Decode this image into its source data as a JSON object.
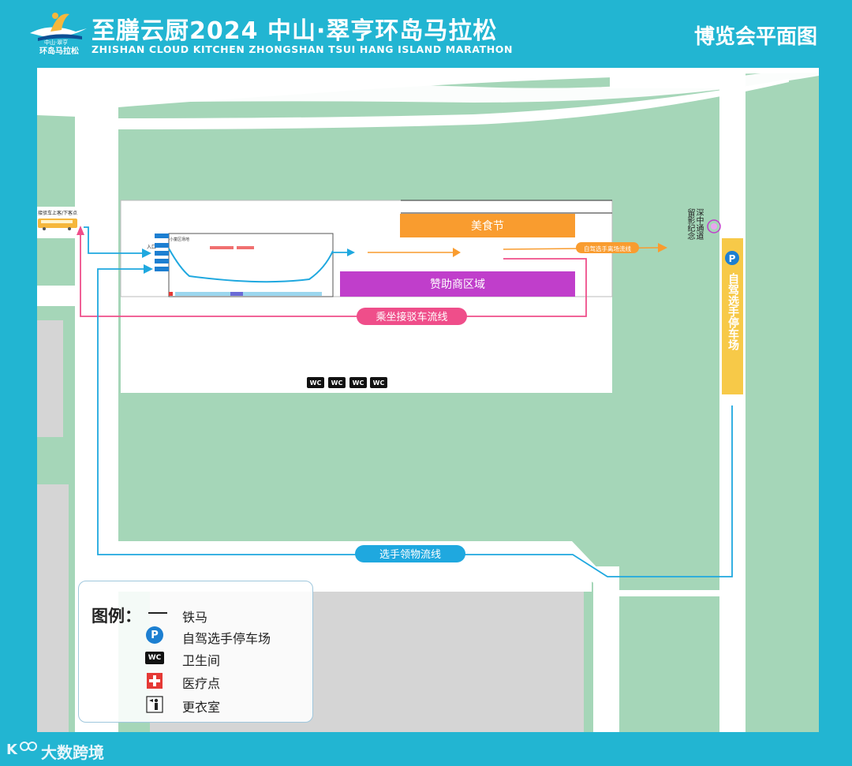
{
  "header": {
    "logo_text_line1": "中山·翠亨",
    "logo_text_line2": "环岛马拉松",
    "title": "至膳云厨2024 中山·翠亨环岛马拉松",
    "subtitle": "ZHISHAN CLOUD KITCHEN ZHONGSHAN TSUI HANG ISLAND MARATHON",
    "page_title": "博览会平面图"
  },
  "map": {
    "shuttle_stop_label": "接驳车上客/下客点",
    "entrance_label": "入口",
    "hall_label": "小童区场地",
    "food_zone": "美食节",
    "sponsor_zone": "赞助商区域",
    "self_drive_exit_flow": "自驾选手离场流线",
    "shuttle_flow": "乘坐接驳车流线",
    "pickup_flow": "选手领物流线",
    "tunnel_label": "深中通道留影纪念",
    "parking_label": "自驾选手停车场",
    "parking_symbol": "P",
    "wc_label": "WC",
    "colors": {
      "grass": "#a5d6b8",
      "road": "#ffffff",
      "food": "#f99c2f",
      "sponsor": "#c03ecb",
      "parking": "#f7c948",
      "pink_flow": "#ef4e8a",
      "blue_flow": "#1fa8df",
      "orange_flow": "#f99c2f"
    }
  },
  "legend": {
    "title": "图例：",
    "items": [
      {
        "symbol": "line",
        "label": "铁马"
      },
      {
        "symbol": "parking-icon",
        "label": "自驾选手停车场",
        "glyph": "P"
      },
      {
        "symbol": "wc-icon",
        "label": "卫生间",
        "glyph": "WC"
      },
      {
        "symbol": "medical-icon",
        "label": "医疗点"
      },
      {
        "symbol": "changing-room-icon",
        "label": "更衣室"
      }
    ]
  },
  "footer": {
    "watermark": "大数跨境"
  }
}
